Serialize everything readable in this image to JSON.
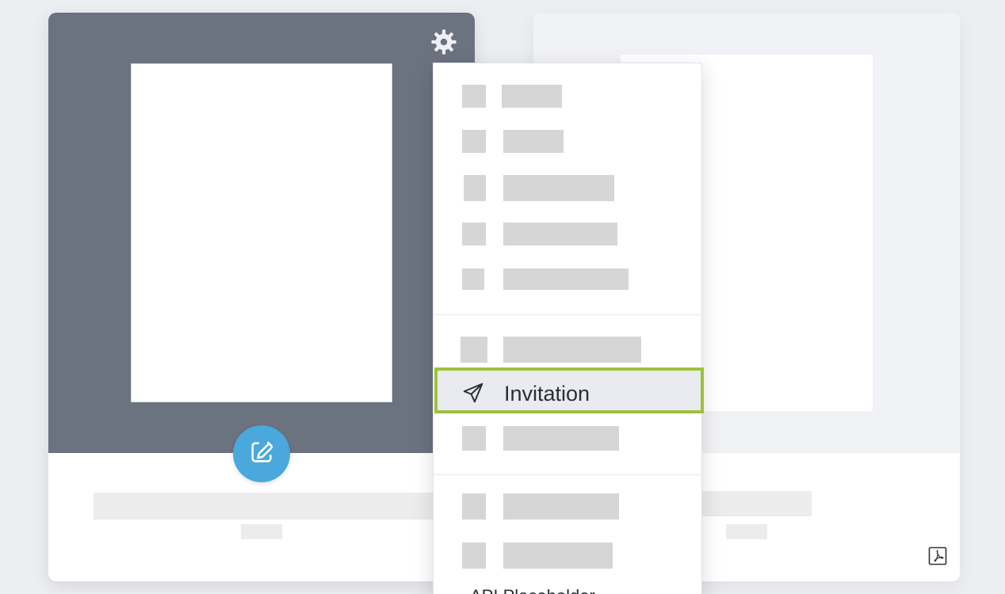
{
  "menu": {
    "highlighted_item": {
      "label": "Invitation",
      "icon": "paper-plane-icon"
    },
    "cut_off_item": {
      "label": "API Placeholder"
    }
  },
  "colors": {
    "card_top_dark": "#6b7280",
    "accent_blue": "#4aa8dc",
    "highlight_green": "#9fc13b"
  },
  "icons": {
    "settings": "gear-icon",
    "edit": "edit-icon",
    "pdf": "pdf-icon"
  }
}
